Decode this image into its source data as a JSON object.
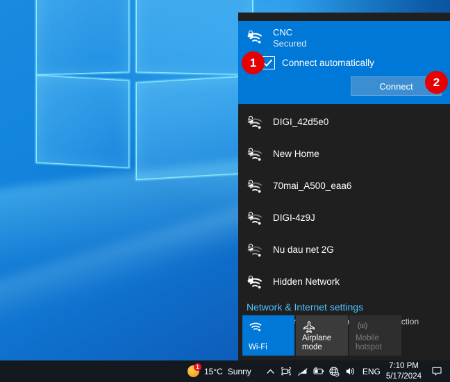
{
  "panel": {
    "selected_network": {
      "name": "CNC",
      "status": "Secured",
      "auto_connect_label": "Connect automatically",
      "auto_connect_checked": true,
      "connect_button": "Connect",
      "icon": "wifi-lock-icon"
    },
    "networks": [
      {
        "name": "DIGI_42d5e0",
        "icon": "wifi-lock-icon",
        "bars": 2
      },
      {
        "name": "New Home",
        "icon": "wifi-lock-icon",
        "bars": 2
      },
      {
        "name": "70mai_A500_eaa6",
        "icon": "wifi-lock-icon",
        "bars": 2
      },
      {
        "name": "DIGI-4z9J",
        "icon": "wifi-lock-icon",
        "bars": 2
      },
      {
        "name": "Nu dau net 2G",
        "icon": "wifi-lock-icon",
        "bars": 1
      },
      {
        "name": "Hidden Network",
        "icon": "wifi-lock-icon",
        "bars": 3
      }
    ],
    "settings": {
      "link": "Network & Internet settings",
      "subtitle": "Change settings, such as making a connection metered."
    },
    "quick_actions": [
      {
        "label": "Wi-Fi",
        "icon": "wifi-icon",
        "state": "on"
      },
      {
        "label": "Airplane mode",
        "icon": "airplane-icon",
        "state": "off"
      },
      {
        "label": "Mobile\nhotspot",
        "icon": "hotspot-icon",
        "state": "disabled"
      }
    ],
    "colors": {
      "accent": "#0078d7",
      "panel_bg": "#1f1f1f",
      "link": "#4cc2ff",
      "badge": "#e60000"
    }
  },
  "callouts": [
    {
      "number": "1",
      "target": "connect-automatically-checkbox"
    },
    {
      "number": "2",
      "target": "connect-button"
    }
  ],
  "taskbar": {
    "weather": {
      "temperature": "15°C",
      "condition": "Sunny",
      "badge": "1",
      "icon": "sun-icon"
    },
    "tray_icons": [
      "chevron-up-icon",
      "camera-icon",
      "network-disconnected-icon",
      "battery-icon",
      "globe-network-icon",
      "speaker-icon"
    ],
    "language": "ENG",
    "time": "7:10 PM",
    "date": "5/17/2024",
    "action_center_icon": "action-center-icon"
  }
}
